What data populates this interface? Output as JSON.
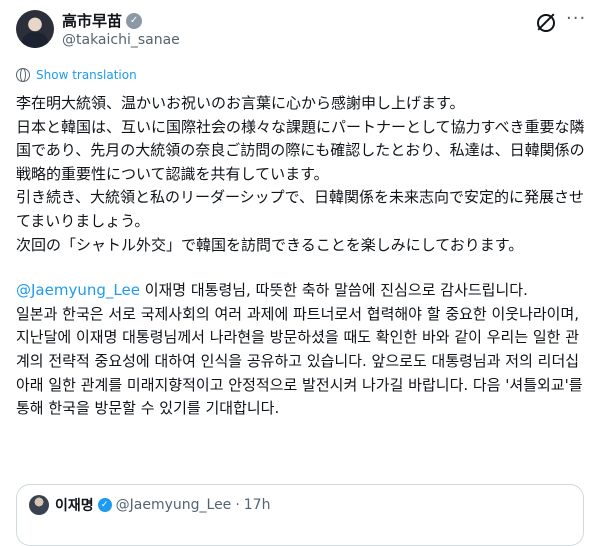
{
  "author": {
    "display_name": "高市早苗",
    "handle": "@takaichi_sanae"
  },
  "icons": {
    "verified": "✓",
    "more": "···"
  },
  "translate": {
    "label": "Show translation"
  },
  "post": {
    "japanese": [
      "李在明大統領、温かいお祝いのお言葉に心から感謝申し上げます。",
      "日本と韓国は、互いに国際社会の様々な課題にパートナーとして協力すべき重要な隣国であり、先月の大統領の奈良ご訪問の際にも確認したとおり、私達は、日韓関係の戦略的重要性について認識を共有しています。",
      "引き続き、大統領と私のリーダーシップで、日韓関係を未来志向で安定的に発展させてまいりましょう。",
      "次回の「シャトル外交」で韓国を訪問できることを楽しみにしております。"
    ],
    "korean_mention": "@Jaemyung_Lee",
    "korean_first": " 이재명 대통령님, 따뜻한 축하 말씀에 진심으로 감사드립니다.",
    "korean_body": "일본과 한국은 서로 국제사회의 여러 과제에 파트너로서 협력해야 할 중요한 이웃나라이며, 지난달에 이재명 대통령님께서 나라현을 방문하셨을 때도 확인한 바와 같이 우리는 일한 관계의 전략적 중요성에 대하여 인식을 공유하고 있습니다. 앞으로도 대통령님과 저의 리더십 아래 일한 관계를 미래지향적이고 안정적으로 발전시켜 나가길 바랍니다. 다음 '셔틀외교'를 통해 한국을 방문할 수 있기를 기대합니다."
  },
  "quote": {
    "name": "이재명",
    "handle": "@Jaemyung_Lee",
    "separator": "·",
    "time": "17h"
  },
  "colors": {
    "accent": "#1d9bf0",
    "text": "#0f1419",
    "secondary": "#536471",
    "border": "#cfd9de"
  }
}
